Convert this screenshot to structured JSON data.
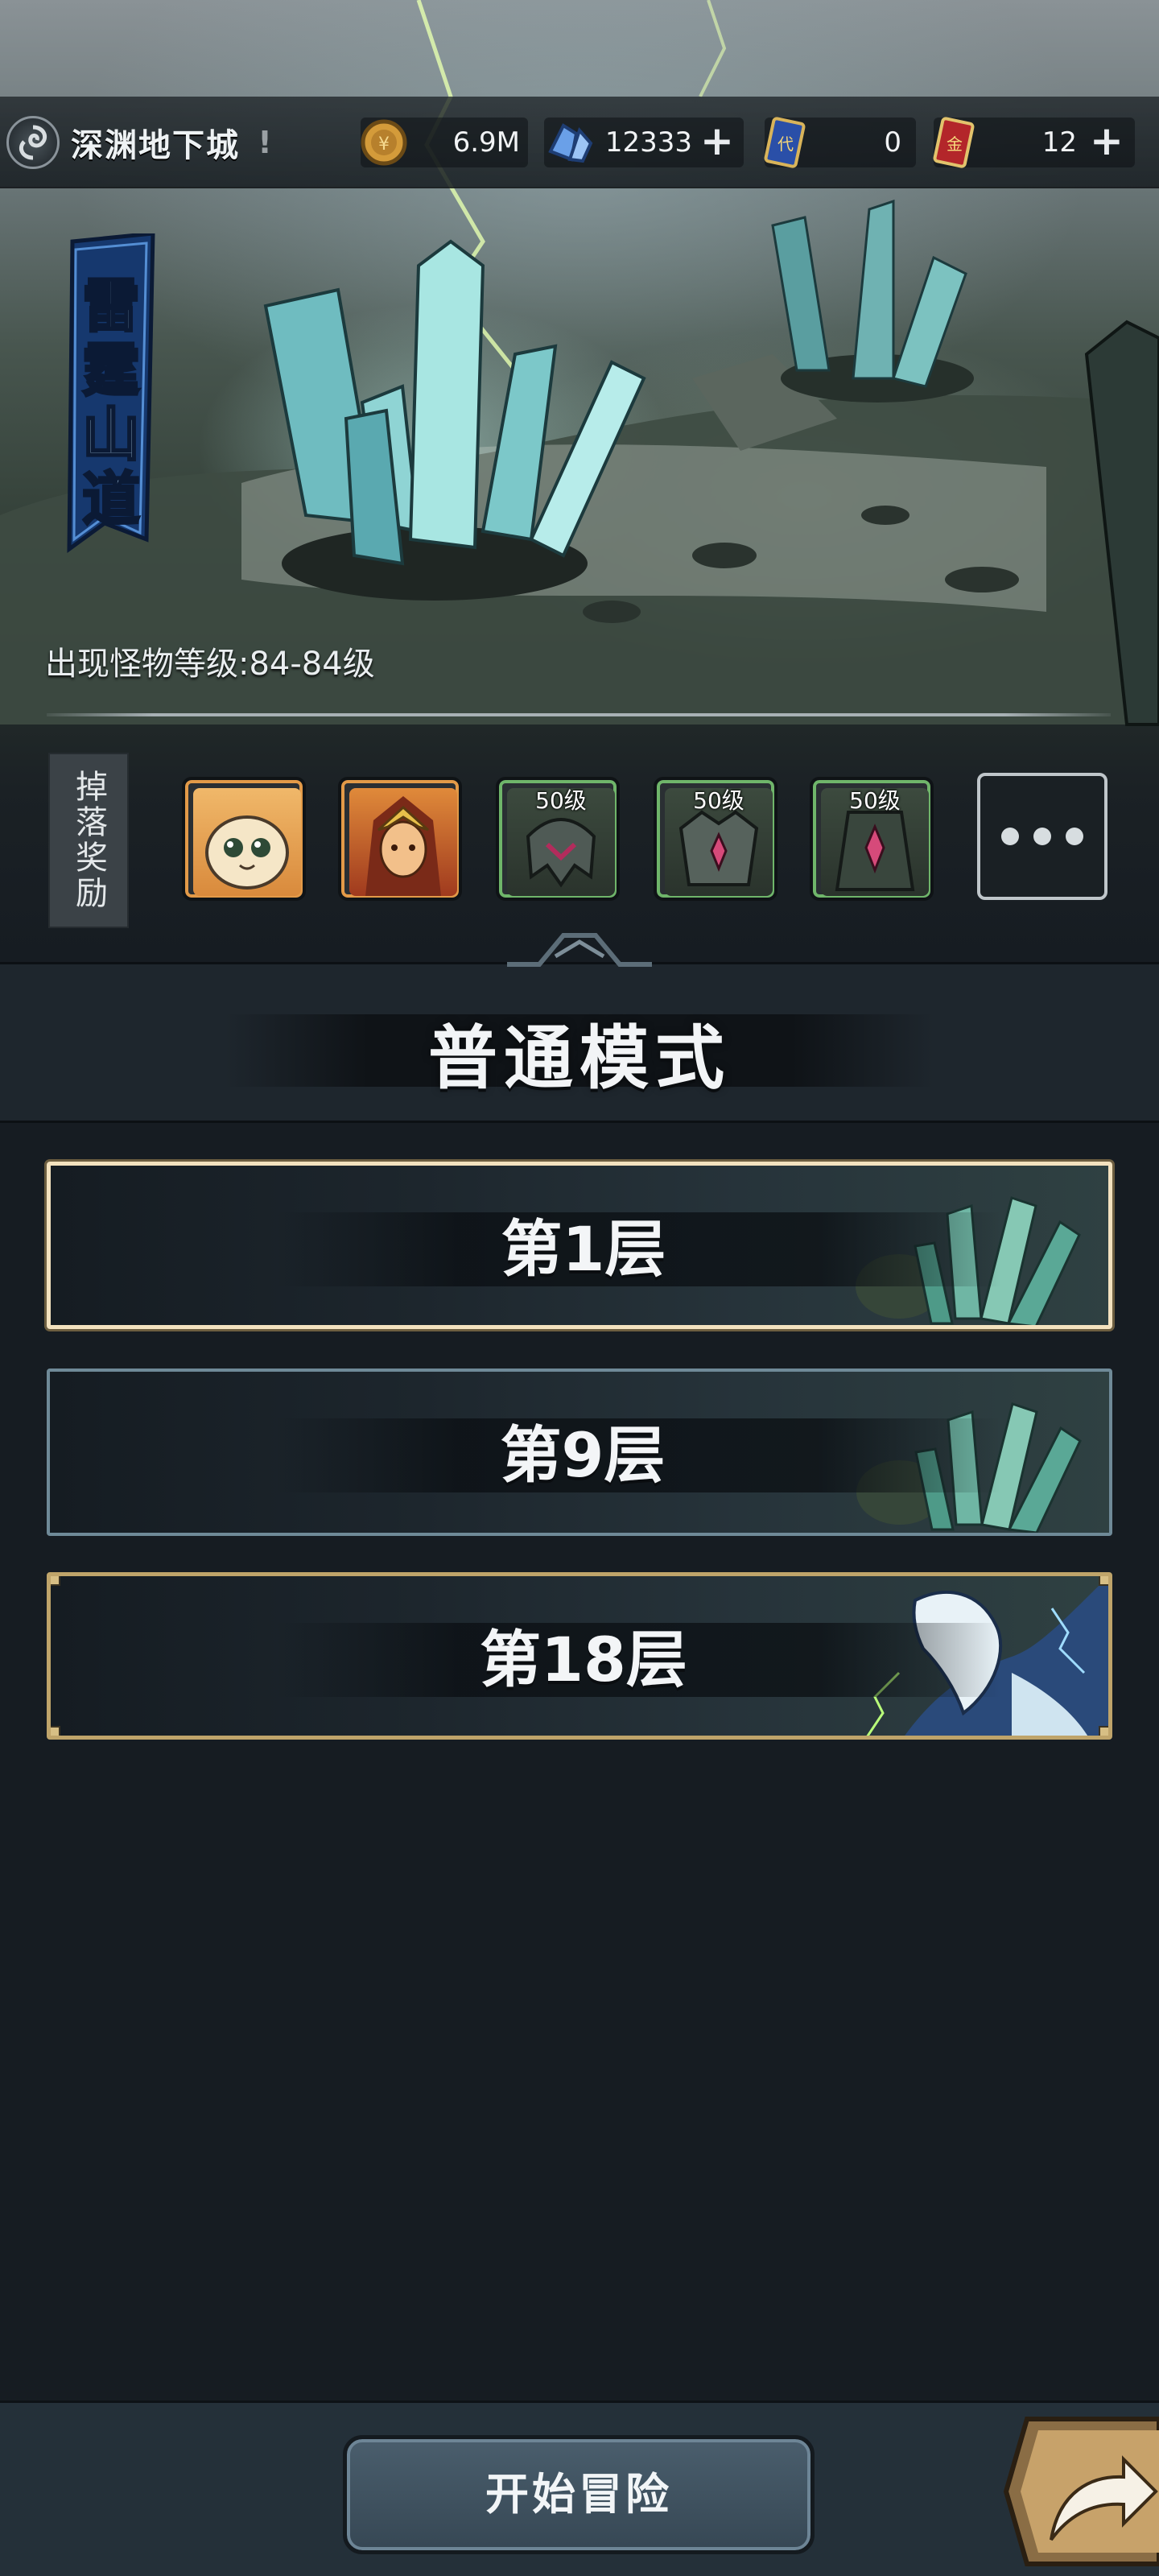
{
  "location": {
    "name": "深渊地下城",
    "alert": "!"
  },
  "resources": {
    "gold": {
      "icon": "gold-coin-icon",
      "value": "6.9M"
    },
    "crystal": {
      "icon": "blue-crystal-icon",
      "value": "12333"
    },
    "ticket_blue": {
      "icon": "blue-ticket-icon",
      "value": "0"
    },
    "ticket_red": {
      "icon": "red-gold-card-icon",
      "value": "12"
    }
  },
  "stage": {
    "title": "雷霆山道",
    "monster_level": "出现怪物等级:84-84级"
  },
  "drops": {
    "label": "掉落奖励",
    "items": [
      {
        "icon": "pet-creature-icon",
        "level": ""
      },
      {
        "icon": "fire-hero-portrait-icon",
        "level": ""
      },
      {
        "icon": "helmet-icon",
        "level": "50级"
      },
      {
        "icon": "armor-icon",
        "level": "50级"
      },
      {
        "icon": "cloak-icon",
        "level": "50级"
      }
    ],
    "more_icon": "ellipsis-icon"
  },
  "mode": {
    "title": "普通模式"
  },
  "floors": [
    {
      "label": "第1层",
      "state": "selected"
    },
    {
      "label": "第9层",
      "state": "normal"
    },
    {
      "label": "第18层",
      "state": "boss"
    }
  ],
  "bottom": {
    "start_label": "开始冒险",
    "share_icon": "share-arrow-icon"
  }
}
